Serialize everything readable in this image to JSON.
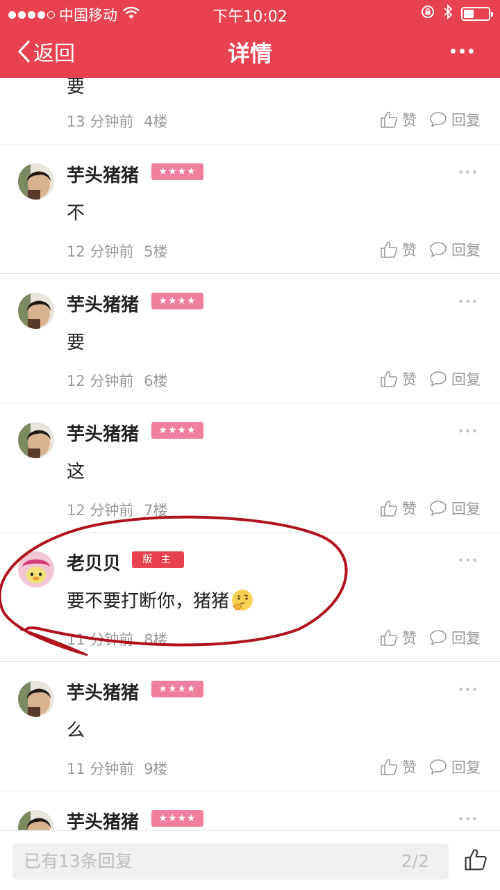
{
  "status_bar": {
    "carrier": "中国移动",
    "time": "下午10:02"
  },
  "nav": {
    "back_label": "返回",
    "title": "详情"
  },
  "top_partial": {
    "content": "要",
    "time": "13 分钟前",
    "floor": "4楼"
  },
  "posts": [
    {
      "user": "芋头猪猪",
      "badge": "★★★★",
      "content": "不",
      "time": "12 分钟前",
      "floor": "5楼"
    },
    {
      "user": "芋头猪猪",
      "badge": "★★★★",
      "content": "要",
      "time": "12 分钟前",
      "floor": "6楼"
    },
    {
      "user": "芋头猪猪",
      "badge": "★★★★",
      "content": "这",
      "time": "12 分钟前",
      "floor": "7楼"
    },
    {
      "user": "老贝贝",
      "badge": "版 主",
      "content": "要不要打断你，猪猪",
      "time": "11 分钟前",
      "floor": "8楼"
    },
    {
      "user": "芋头猪猪",
      "badge": "★★★★",
      "content": "么",
      "time": "11 分钟前",
      "floor": "9楼"
    },
    {
      "user": "芋头猪猪",
      "badge": "★★★★"
    }
  ],
  "actions": {
    "like_label": "赞",
    "reply_label": "回复"
  },
  "bottom": {
    "placeholder": "已有13条回复",
    "page": "2/2"
  },
  "colors": {
    "brand_red": "#e8414f",
    "star_badge": "#ef7f9d",
    "annotation": "#b0121b"
  }
}
